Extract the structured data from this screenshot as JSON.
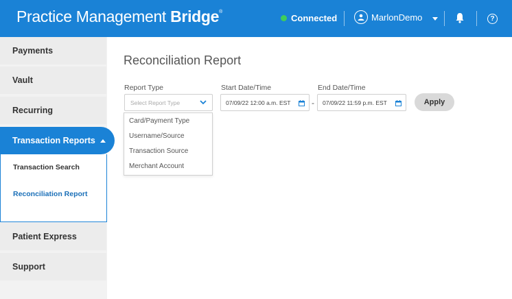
{
  "header": {
    "brand_regular": "Practice Management",
    "brand_bold": "Bridge",
    "brand_mark": "®",
    "status_label": "Connected",
    "username": "MarlonDemo",
    "help_glyph": "?",
    "icons": [
      "status-dot",
      "user-avatar-icon",
      "chevron-down-icon",
      "bell-icon",
      "help-icon"
    ]
  },
  "sidebar": {
    "items": [
      {
        "label": "Payments"
      },
      {
        "label": "Vault"
      },
      {
        "label": "Recurring"
      },
      {
        "label": "Transaction Reports",
        "active": true
      },
      {
        "label": "Patient Express"
      },
      {
        "label": "Support"
      }
    ],
    "sub_items": [
      {
        "label": "Transaction Search"
      },
      {
        "label": "Reconciliation Report",
        "active": true
      }
    ]
  },
  "main": {
    "title": "Reconciliation Report",
    "report_type": {
      "label": "Report Type",
      "placeholder": "Select Report Type",
      "options": [
        "Card/Payment Type",
        "Username/Source",
        "Transaction Source",
        "Merchant Account"
      ]
    },
    "start": {
      "label": "Start Date/Time",
      "value": "07/09/22  12:00 a.m. EST"
    },
    "end": {
      "label": "End Date/Time",
      "value": "07/09/22  11:59 p.m. EST"
    },
    "separator": "-",
    "apply_label": "Apply"
  },
  "colors": {
    "brand_blue": "#1a82d6",
    "connected_green": "#3fcd5a",
    "active_sub_text": "#1a6fb8",
    "apply_bg": "#d9d9d9"
  }
}
